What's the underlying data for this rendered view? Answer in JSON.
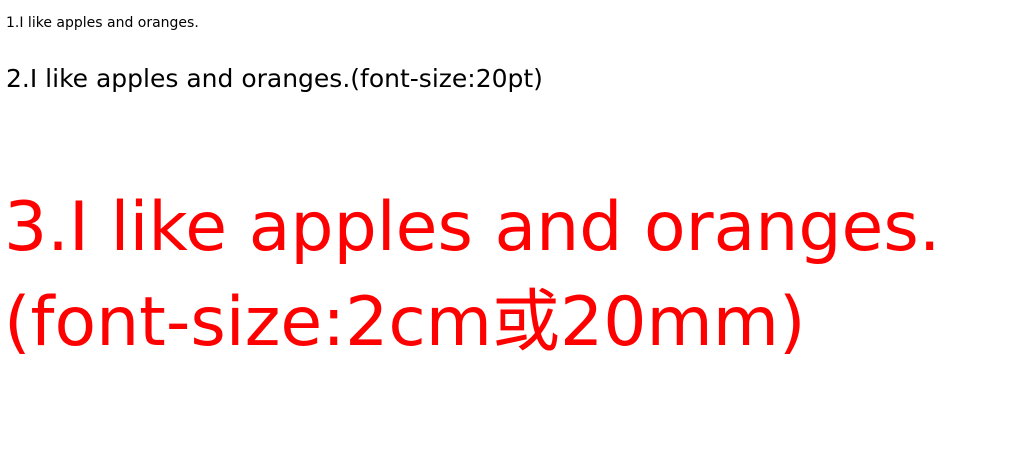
{
  "lines": [
    {
      "text": "1.I like apples and oranges.",
      "color": "#000000"
    },
    {
      "text": "2.I like apples and oranges.(font-size:20pt)",
      "color": "#000000"
    },
    {
      "text": "3.I like apples and oranges.(font-size:2cm或20mm)",
      "color": "#ff0000"
    }
  ]
}
